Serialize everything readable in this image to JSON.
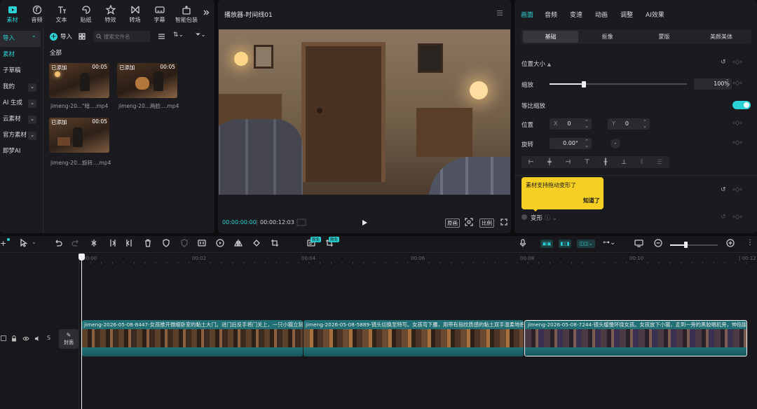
{
  "top_tabs": [
    {
      "label": "素材",
      "icon": "media-icon"
    },
    {
      "label": "音频",
      "icon": "audio-icon"
    },
    {
      "label": "文本",
      "icon": "text-icon"
    },
    {
      "label": "贴纸",
      "icon": "sticker-icon"
    },
    {
      "label": "特效",
      "icon": "effects-icon"
    },
    {
      "label": "转场",
      "icon": "transition-icon"
    },
    {
      "label": "字幕",
      "icon": "caption-icon"
    },
    {
      "label": "智能包装",
      "icon": "smart-pack-icon"
    }
  ],
  "sidebar": {
    "items": [
      {
        "label": "导入"
      },
      {
        "label": "素材"
      },
      {
        "label": "子草稿"
      },
      {
        "label": "我的"
      },
      {
        "label": "AI 生成"
      },
      {
        "label": "云素材"
      },
      {
        "label": "官方素材"
      },
      {
        "label": "即梦AI"
      }
    ]
  },
  "media": {
    "import_label": "导入",
    "search_placeholder": "搜索文件名",
    "section_title": "全部",
    "items": [
      {
        "tag": "已添加",
        "duration": "00:05",
        "name": "jimeng-20...\"暗....mp4"
      },
      {
        "tag": "已添加",
        "duration": "00:05",
        "name": "jimeng-20...两脸....mp4"
      },
      {
        "tag": "已添加",
        "duration": "00:05",
        "name": "jimeng-20...旋转....mp4"
      }
    ]
  },
  "player": {
    "title": "播放器-时间线01",
    "current_time": "00:00:00:00",
    "total_time": "00:00:12:03",
    "original_label": "原画",
    "ratio_label": "比例"
  },
  "inspector": {
    "tabs": [
      "画面",
      "音频",
      "变速",
      "动画",
      "调整",
      "AI效果"
    ],
    "subtabs": [
      "基础",
      "抠像",
      "蒙版",
      "美颜美体"
    ],
    "position_size": "位置大小",
    "scale_label": "缩放",
    "scale_value": "100%",
    "scale_fraction": 0.25,
    "uniform_scale": "等比缩放",
    "position_label": "位置",
    "x_label": "X",
    "x_value": "0",
    "y_label": "Y",
    "y_value": "0",
    "rotate_label": "旋转",
    "rotate_value": "0.00°",
    "tooltip_text": "素材支持拖动变形了",
    "tooltip_button": "知道了",
    "transform_label": "变形"
  },
  "timeline": {
    "ruler": [
      "00:00",
      "00:02",
      "00:04",
      "00:06",
      "00:08",
      "00:10"
    ],
    "cover_label": "封面",
    "track_s": "S",
    "free_badges": [
      "限免",
      "限免"
    ],
    "clips": [
      {
        "name": "jimeng-2026-05-08-8447-女孩推开微缩卧室的黏土大门。进门后反手将门关上，一只小猫立刻"
      },
      {
        "name": "jimeng-2026-05-08-5889-镜头切换至特写。女孩弯下腰，用带有指纹质感的黏土双手温柔地抱"
      },
      {
        "name": "jimeng-2026-05-08-7244-镜头缓慢环绕女孩。女孩放下小猫，走到一旁的黑胶唱机旁，伸指拨"
      }
    ]
  },
  "colors": {
    "accent": "#2bd2d5",
    "tooltip": "#f5cf22",
    "clip_bg": "#1f6f74"
  }
}
